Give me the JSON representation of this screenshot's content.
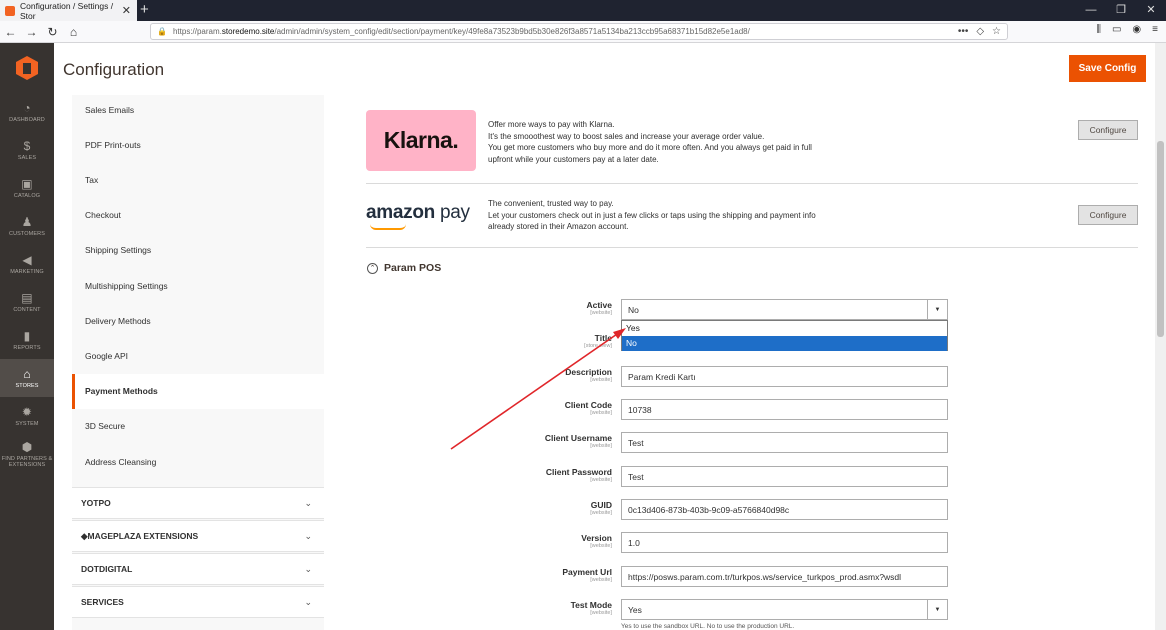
{
  "browser": {
    "tab_title": "Configuration / Settings / Stor",
    "tab_close": "✕",
    "new_tab": "+",
    "url_prefix": "https://param.",
    "url_host": "storedemo.site",
    "url_rest": "/admin/admin/system_config/edit/section/payment/key/49fe8a73523b9bd5b30e826f3a8571a5134ba213ccb95a68371b15d82e5e1ad8/",
    "url_dots": "•••"
  },
  "admin_nav": [
    {
      "label": "DASHBOARD",
      "icon": "dashboard-icon",
      "glyph": "◔"
    },
    {
      "label": "SALES",
      "icon": "dollar-icon",
      "glyph": "$"
    },
    {
      "label": "CATALOG",
      "icon": "box-icon",
      "glyph": "▣"
    },
    {
      "label": "CUSTOMERS",
      "icon": "person-icon",
      "glyph": "♟"
    },
    {
      "label": "MARKETING",
      "icon": "megaphone-icon",
      "glyph": "◀"
    },
    {
      "label": "CONTENT",
      "icon": "content-icon",
      "glyph": "▤"
    },
    {
      "label": "REPORTS",
      "icon": "bar-chart-icon",
      "glyph": "▮"
    },
    {
      "label": "STORES",
      "icon": "store-icon",
      "glyph": "⌂"
    },
    {
      "label": "SYSTEM",
      "icon": "gear-icon",
      "glyph": "✹"
    },
    {
      "label": "FIND PARTNERS & EXTENSIONS",
      "icon": "puzzle-icon",
      "glyph": "⬢"
    }
  ],
  "header": {
    "title": "Configuration",
    "save_label": "Save Config"
  },
  "config_tabs": {
    "items": [
      "Sales Emails",
      "PDF Print-outs",
      "Tax",
      "Checkout",
      "Shipping Settings",
      "Multishipping Settings",
      "Delivery Methods",
      "Google API",
      "Payment Methods",
      "3D Secure",
      "Address Cleansing"
    ],
    "active": "Payment Methods",
    "sections": [
      "YOTPO",
      "MAGEPLAZA EXTENSIONS",
      "DOTDIGITAL",
      "SERVICES"
    ]
  },
  "klarna": {
    "logo_text": "Klarna.",
    "lines": [
      "Offer more ways to pay with Klarna.",
      "It's the smooothest way to boost sales and increase your average order value.",
      "You get more customers who buy more and do it more often. And you always get paid in full",
      "upfront while your customers pay at a later date."
    ],
    "button": "Configure"
  },
  "amazon": {
    "logo_amazon": "amazon",
    "logo_pay": "pay",
    "lines": [
      "The convenient, trusted way to pay.",
      "Let your customers check out in just a few clicks or taps using the shipping and payment info",
      "already stored in their Amazon account."
    ],
    "button": "Configure"
  },
  "param_pos": {
    "heading": "Param POS",
    "fields": [
      {
        "label": "Active",
        "scope": "[website]",
        "value": "No",
        "type": "select"
      },
      {
        "label": "Title",
        "scope": "[store view]",
        "value": "",
        "type": "text"
      },
      {
        "label": "Description",
        "scope": "[website]",
        "value": "Param Kredi Kartı",
        "type": "text"
      },
      {
        "label": "Client Code",
        "scope": "[website]",
        "value": "10738",
        "type": "text"
      },
      {
        "label": "Client Username",
        "scope": "[website]",
        "value": "Test",
        "type": "text"
      },
      {
        "label": "Client Password",
        "scope": "[website]",
        "value": "Test",
        "type": "text"
      },
      {
        "label": "GUID",
        "scope": "[website]",
        "value": "0c13d406-873b-403b-9c09-a5766840d98c",
        "type": "text"
      },
      {
        "label": "Version",
        "scope": "[website]",
        "value": "1.0",
        "type": "text"
      },
      {
        "label": "Payment Url",
        "scope": "[website]",
        "value": "https://posws.param.com.tr/turkpos.ws/service_turkpos_prod.asmx?wsdl",
        "type": "text"
      },
      {
        "label": "Test Mode",
        "scope": "[website]",
        "value": "Yes",
        "type": "select"
      }
    ],
    "active_options": [
      "Yes",
      "No"
    ],
    "active_selected": "No",
    "test_mode_hint": "Yes to use the sandbox URL. No to use the production URL."
  },
  "colors": {
    "accent": "#eb5202",
    "admin_nav_bg": "#373330",
    "annotation_arrow": "#e0262a",
    "option_highlight": "#1e6ec8"
  }
}
